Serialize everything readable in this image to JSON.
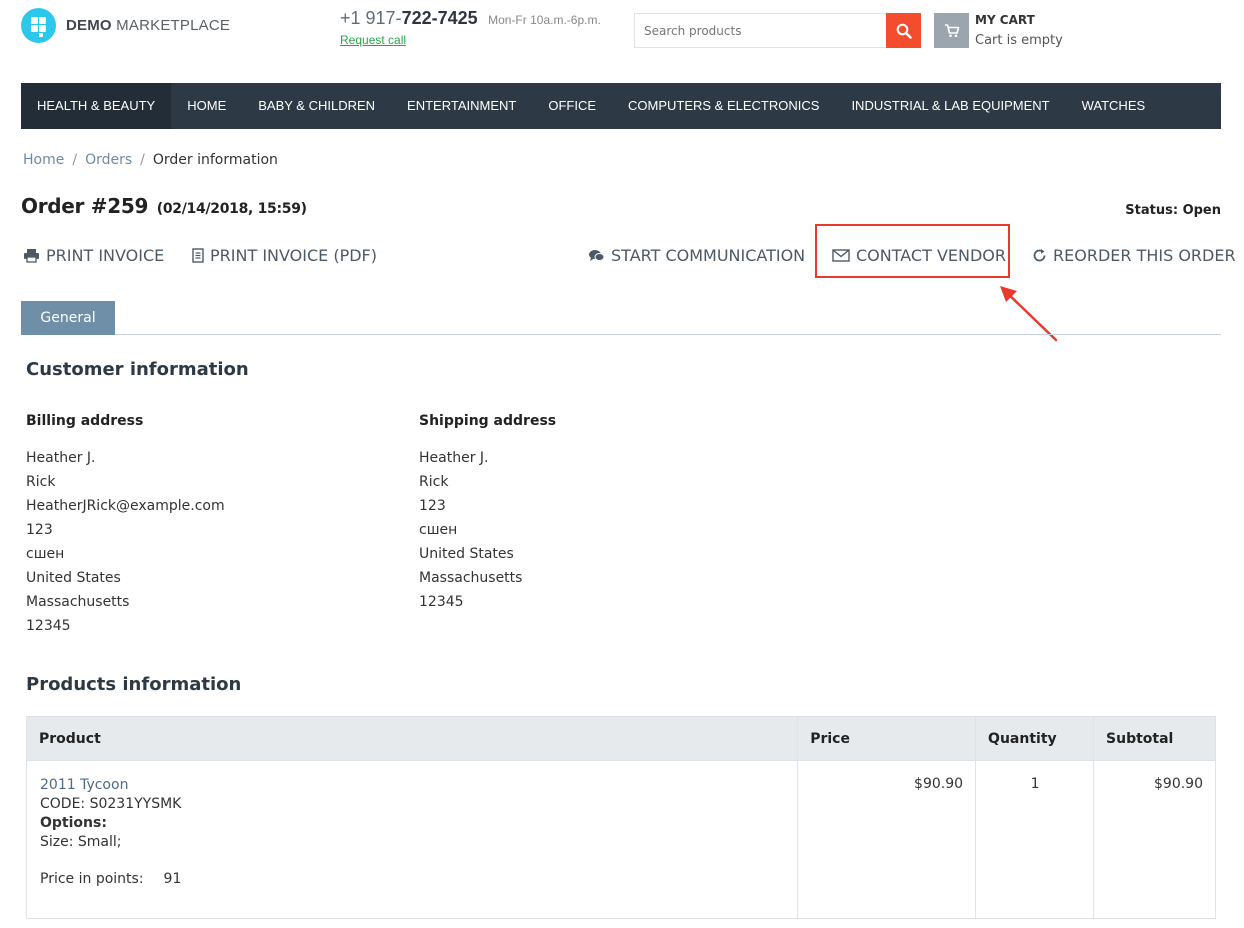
{
  "header": {
    "logo": {
      "bold": "DEMO",
      "rest": " MARKETPLACE"
    },
    "phone": {
      "prefix": "+1 917-",
      "main": "722-7425",
      "hours": "Mon-Fr 10a.m.-6p.m.",
      "request_call": "Request call"
    },
    "search": {
      "placeholder": "Search products"
    },
    "cart": {
      "title": "MY CART",
      "status": "Cart is empty"
    }
  },
  "nav": {
    "items": [
      "HEALTH & BEAUTY",
      "HOME",
      "BABY & CHILDREN",
      "ENTERTAINMENT",
      "OFFICE",
      "COMPUTERS & ELECTRONICS",
      "INDUSTRIAL & LAB EQUIPMENT",
      "WATCHES"
    ],
    "active": "HEALTH & BEAUTY"
  },
  "breadcrumb": {
    "home": "Home",
    "orders": "Orders",
    "current": "Order information",
    "separator": "/"
  },
  "order": {
    "title": "Order #259",
    "date": "(02/14/2018, 15:59)",
    "status": "Status: Open"
  },
  "actions": {
    "print_invoice": "PRINT INVOICE",
    "print_invoice_pdf": "PRINT INVOICE (PDF)",
    "start_communication": "START COMMUNICATION",
    "contact_vendor": "CONTACT VENDOR",
    "reorder": "REORDER THIS ORDER"
  },
  "tabs": {
    "general": "General"
  },
  "customer": {
    "section_title": "Customer information",
    "billing": {
      "title": "Billing address",
      "lines": [
        "Heather J.",
        "Rick",
        "HeatherJRick@example.com",
        "123",
        "сшен",
        "United States",
        "Massachusetts",
        "12345"
      ]
    },
    "shipping": {
      "title": "Shipping address",
      "lines": [
        "Heather J.",
        "Rick",
        "123",
        "сшен",
        "United States",
        "Massachusetts",
        "12345"
      ]
    }
  },
  "products": {
    "section_title": "Products information",
    "headers": {
      "product": "Product",
      "price": "Price",
      "quantity": "Quantity",
      "subtotal": "Subtotal"
    },
    "rows": [
      {
        "name": "2011 Tycoon",
        "code": "CODE: S0231YYSMK",
        "options_label": "Options:",
        "size": "Size: Small;",
        "points_label": "Price in points:",
        "points_value": "91",
        "price": "$90.90",
        "quantity": "1",
        "subtotal": "$90.90"
      }
    ]
  },
  "colors": {
    "accent_orange": "#f34d2e",
    "logo_cyan": "#2bc8ec",
    "nav_bg": "#2d3a45",
    "tab_bg": "#6f8ea8",
    "highlight_red": "#e8392d",
    "request_call_green": "#2ca54a"
  }
}
